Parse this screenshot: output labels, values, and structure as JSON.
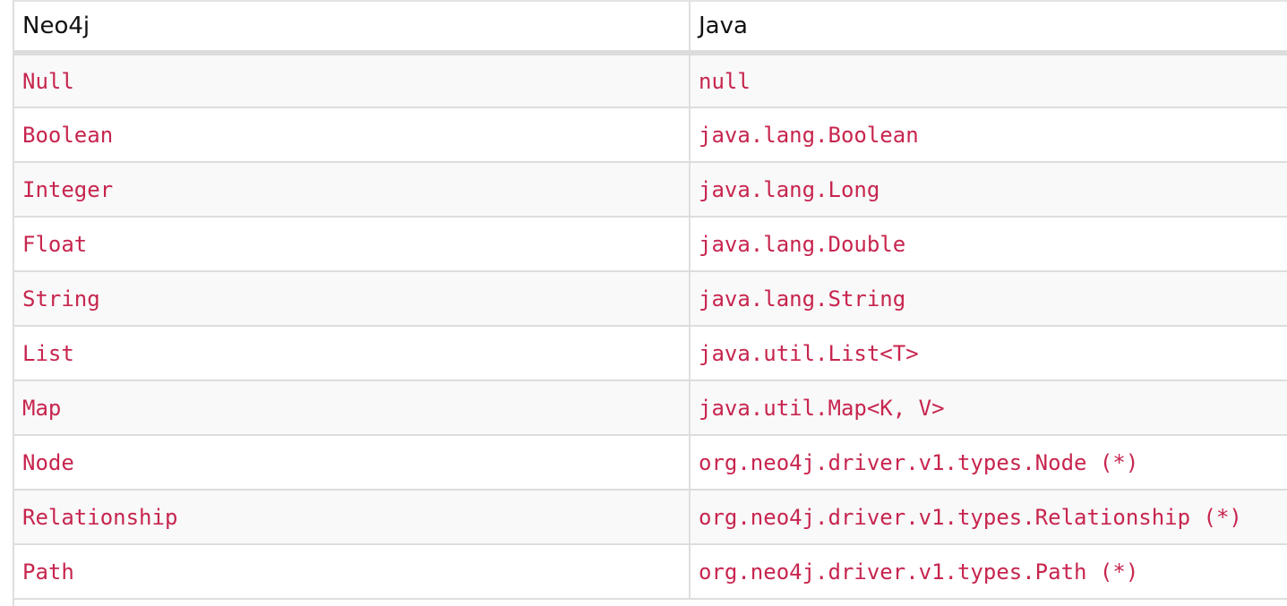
{
  "table": {
    "columns": [
      "Neo4j",
      "Java"
    ],
    "rows": [
      [
        "Null",
        "null"
      ],
      [
        "Boolean",
        "java.lang.Boolean"
      ],
      [
        "Integer",
        "java.lang.Long"
      ],
      [
        "Float",
        "java.lang.Double"
      ],
      [
        "String",
        "java.lang.String"
      ],
      [
        "List",
        "java.util.List<T>"
      ],
      [
        "Map",
        "java.util.Map<K, V>"
      ],
      [
        "Node",
        "org.neo4j.driver.v1.types.Node (*)"
      ],
      [
        "Relationship",
        "org.neo4j.driver.v1.types.Relationship (*)"
      ],
      [
        "Path",
        "org.neo4j.driver.v1.types.Path (*)"
      ]
    ]
  },
  "colors": {
    "code_text": "#c7254e",
    "header_text": "#111111",
    "stripe": "#f9f9f9",
    "border": "#dddddd"
  }
}
